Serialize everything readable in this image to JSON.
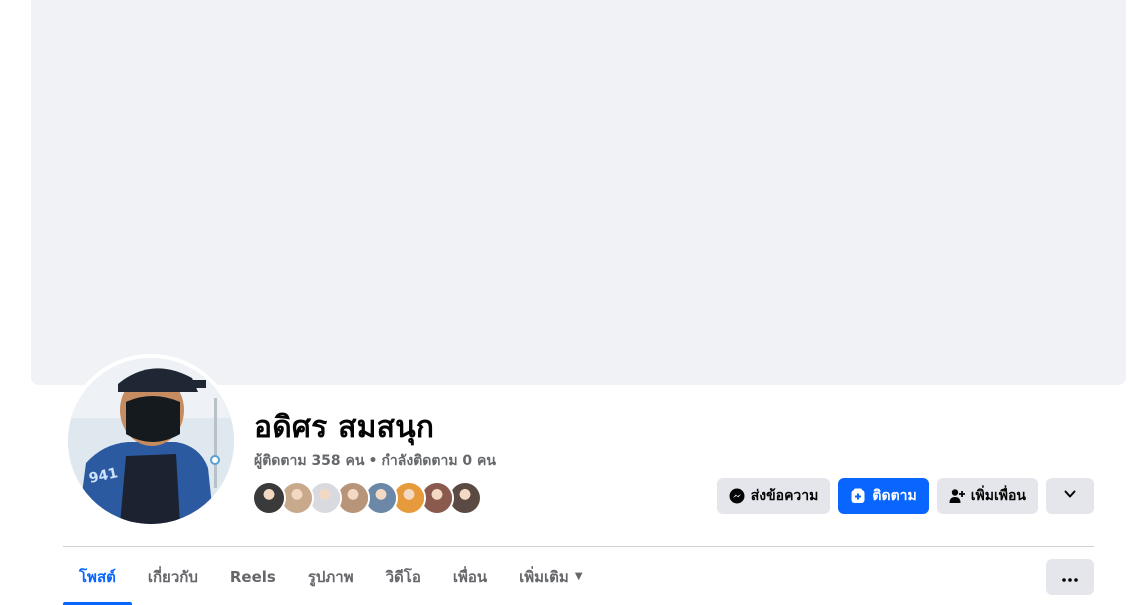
{
  "profile": {
    "name": "อดิศร สมสนุก",
    "followers_label": "ผู้ติดตาม 358 คน",
    "separator": "•",
    "following_label": "กำลังติดตาม 0 คน"
  },
  "friends_preview": [
    {
      "color": "#3a3a3a"
    },
    {
      "color": "#c9a98b"
    },
    {
      "color": "#d8dadf"
    },
    {
      "color": "#b89478"
    },
    {
      "color": "#6b88a8"
    },
    {
      "color": "#e79a3c"
    },
    {
      "color": "#8a5a4e"
    },
    {
      "color": "#5b4a44"
    }
  ],
  "actions": {
    "message_label": "ส่งข้อความ",
    "follow_label": "ติดตาม",
    "add_friend_label": "เพิ่มเพื่อน"
  },
  "tabs": [
    {
      "label": "โพสต์",
      "active": true
    },
    {
      "label": "เกี่ยวกับ",
      "active": false
    },
    {
      "label": "Reels",
      "active": false
    },
    {
      "label": "รูปภาพ",
      "active": false
    },
    {
      "label": "วิดีโอ",
      "active": false
    },
    {
      "label": "เพื่อน",
      "active": false
    },
    {
      "label": "เพิ่มเติม",
      "active": false
    }
  ],
  "colors": {
    "accent": "#0866ff",
    "cover": "#f0f2f5",
    "secondary_text": "#65676b",
    "button_grey": "#e4e6eb"
  }
}
